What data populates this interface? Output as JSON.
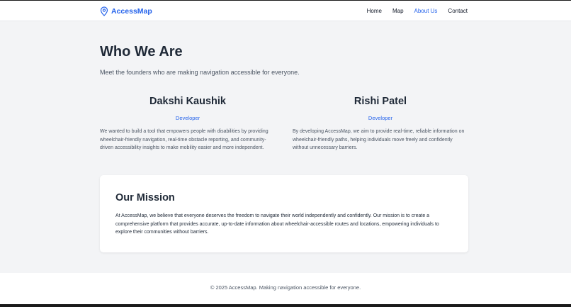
{
  "header": {
    "brand": "AccessMap",
    "nav": [
      "Home",
      "Map",
      "About Us",
      "Contact"
    ],
    "active_nav": "About Us"
  },
  "hero": {
    "title": "Who We Are",
    "subtitle": "Meet the founders who are making navigation accessible for everyone."
  },
  "founders": [
    {
      "name": "Dakshi Kaushik",
      "role": "Developer",
      "bio": "We wanted to build a tool that empowers people with disabilities by providing wheelchair-friendly navigation, real-time obstacle reporting, and community-driven accessibility insights to make mobility easier and more independent."
    },
    {
      "name": "Rishi Patel",
      "role": "Developer",
      "bio": "By developing AccessMap, we aim to provide real-time, reliable information on wheelchair-friendly paths, helping individuals move freely and confidently without unnecessary barriers."
    }
  ],
  "mission": {
    "title": "Our Mission",
    "text": "At AccessMap, we believe that everyone deserves the freedom to navigate their world independently and confidently. Our mission is to create a comprehensive platform that provides accurate, up-to-date information about wheelchair-accessible routes and locations, empowering individuals to explore their communities without barriers."
  },
  "footer": {
    "text": "© 2025 AccessMap. Making navigation accessible for everyone."
  },
  "colors": {
    "accent": "#2563eb",
    "background": "#f3f4f6",
    "text": "#1f2937"
  },
  "icons": {
    "brand": "map-pin-icon"
  }
}
